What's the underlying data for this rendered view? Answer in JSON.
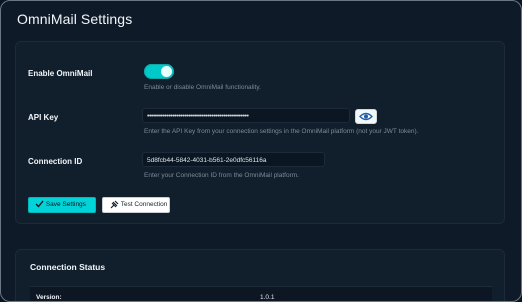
{
  "page": {
    "title": "OmniMail Settings"
  },
  "settings": {
    "enable": {
      "label": "Enable OmniMail",
      "help": "Enable or disable OmniMail functionality.",
      "enabled": true
    },
    "api_key": {
      "label": "API Key",
      "value": "••••••••••••••••••••••••••••••••••••••••••••••••••••",
      "help": "Enter the API Key from your connection settings in the OmniMail platform (not your JWT token)."
    },
    "connection_id": {
      "label": "Connection ID",
      "value": "5d8fcb44-5842-4031-b561-2e0dfc56116a",
      "help": "Enter your Connection ID from the OmniMail platform."
    }
  },
  "buttons": {
    "save": "Save Settings",
    "test": "Test Connection"
  },
  "status": {
    "title": "Connection Status",
    "rows": [
      {
        "key": "Version:",
        "value": "1.0.1"
      }
    ]
  },
  "colors": {
    "accent": "#00d4d8",
    "background": "#0e1a27"
  },
  "icons": {
    "eye": "eye-icon",
    "save": "check-icon",
    "test": "plug-icon"
  }
}
